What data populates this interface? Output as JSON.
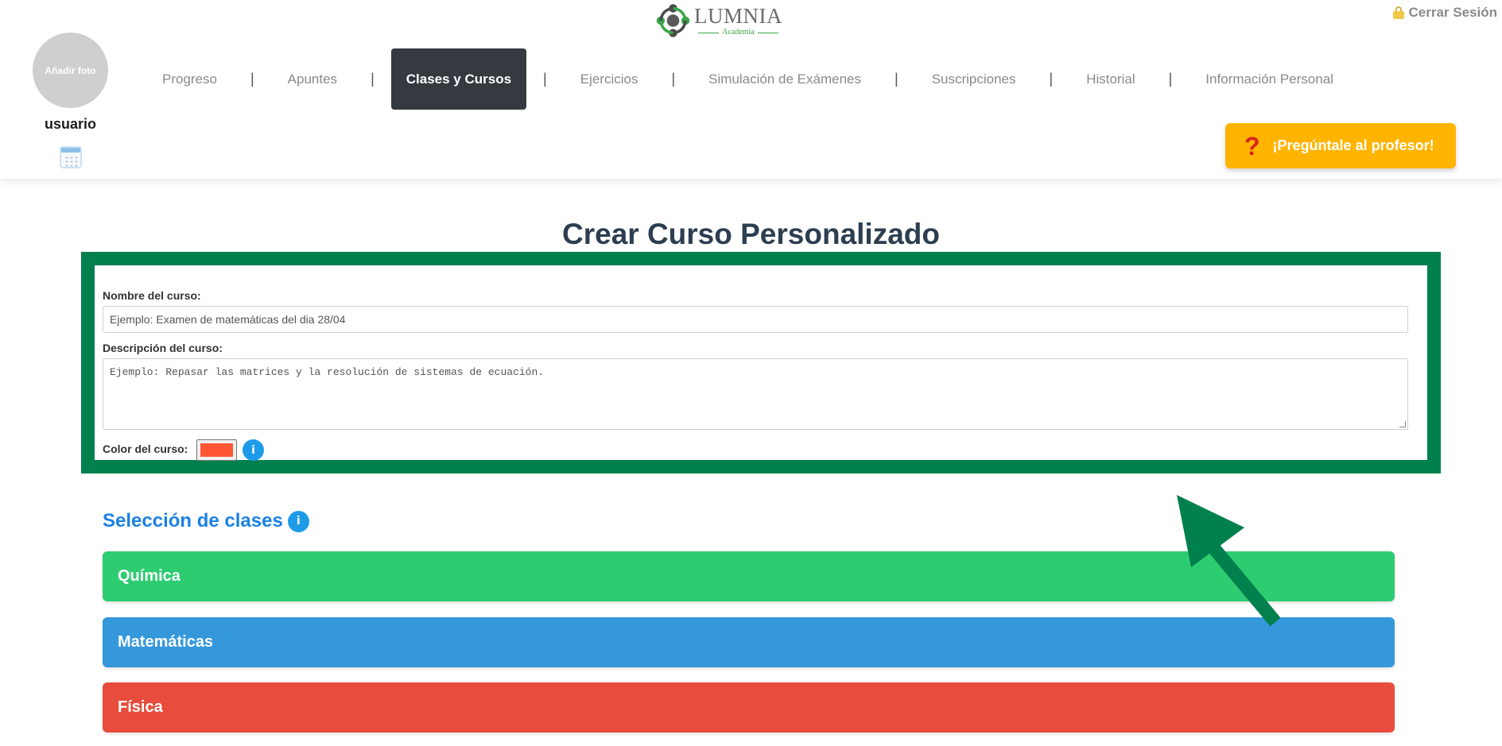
{
  "header": {
    "logo_name": "LUMNIA",
    "logo_sub": "Academia",
    "logout_label": "Cerrar Sesión",
    "avatar_label": "Añadir foto",
    "username": "usuario",
    "ask_button": "¡Pregúntale al profesor!",
    "ask_icon_glyph": "?"
  },
  "nav": {
    "items": [
      {
        "label": "Progreso",
        "active": false
      },
      {
        "label": "Apuntes",
        "active": false
      },
      {
        "label": "Clases y Cursos",
        "active": true
      },
      {
        "label": "Ejercicios",
        "active": false
      },
      {
        "label": "Simulación de Exámenes",
        "active": false
      },
      {
        "label": "Suscripciones",
        "active": false
      },
      {
        "label": "Historial",
        "active": false
      },
      {
        "label": "Información Personal",
        "active": false
      }
    ],
    "separator": "|"
  },
  "main": {
    "title": "Crear Curso Personalizado",
    "form": {
      "name_label": "Nombre del curso:",
      "name_placeholder": "Ejemplo: Examen de matemáticas del dia 28/04",
      "description_label": "Descripción del curso:",
      "description_placeholder": "Ejemplo: Repasar las matrices y la resolución de sistemas de ecuación.",
      "color_label": "Color del curso:",
      "color_value": "#ff5733",
      "info_glyph": "i"
    },
    "selection_title": "Selección de clases",
    "classes": [
      {
        "label": "Química",
        "color": "#2ecc71"
      },
      {
        "label": "Matemáticas",
        "color": "#3498db"
      },
      {
        "label": "Física",
        "color": "#e74c3c"
      }
    ]
  },
  "colors": {
    "accent_green": "#00804d",
    "nav_active_bg": "#343a40",
    "ask_button_bg": "#ffb400",
    "title_color": "#2c3e50",
    "selection_title_color": "#1a82e2",
    "info_blue": "#1e9be8"
  },
  "icons": [
    "logo-icon",
    "lock-icon",
    "calendar-icon",
    "question-icon",
    "info-icon",
    "arrow-annotation"
  ]
}
